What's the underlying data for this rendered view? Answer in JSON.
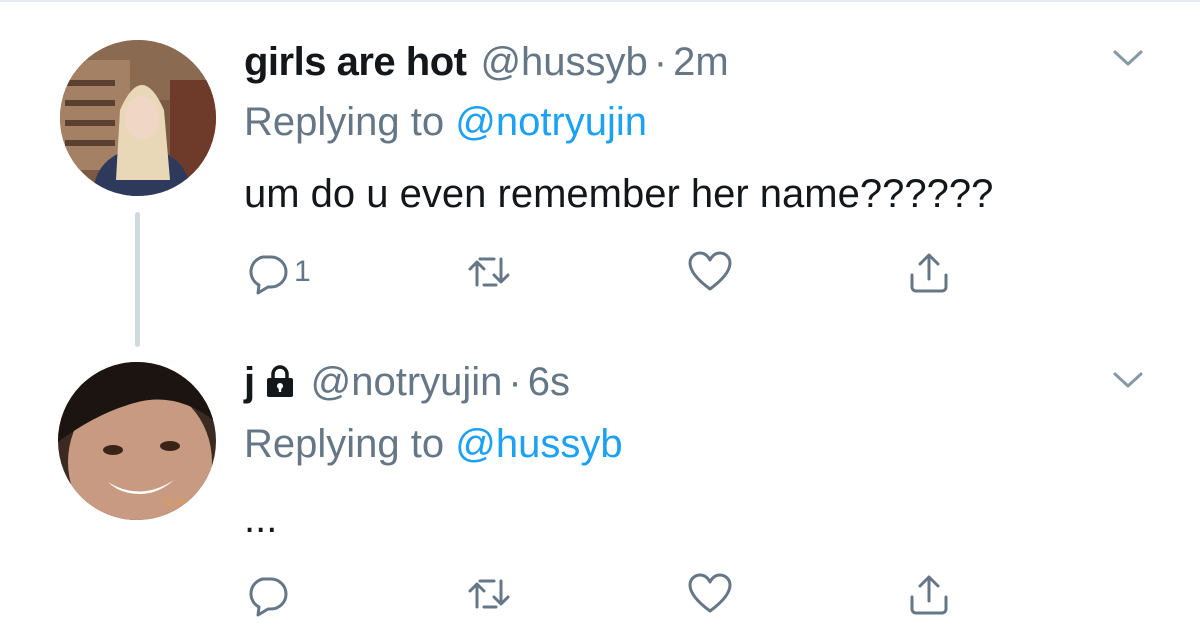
{
  "tweets": [
    {
      "display_name": "girls are hot",
      "handle": "@hussyb",
      "separator": "·",
      "time": "2m",
      "replying_prefix": "Replying to",
      "replying_to": "@notryujin",
      "text": "um do u even remember her name??????",
      "reply_count": "1",
      "protected": false
    },
    {
      "display_name": "j",
      "handle": "@notryujin",
      "separator": "·",
      "time": "6s",
      "replying_prefix": "Replying to",
      "replying_to": "@hussyb",
      "text": "...",
      "reply_count": "",
      "protected": true
    }
  ],
  "icons": {
    "reply": "reply-icon",
    "retweet": "retweet-icon",
    "like": "heart-icon",
    "share": "share-icon",
    "more": "chevron-down-icon",
    "lock": "lock-icon"
  },
  "colors": {
    "text": "#14171a",
    "secondary": "#657786",
    "link": "#1da1f2",
    "icon": "#657786",
    "thread_line": "#cfd9de"
  }
}
